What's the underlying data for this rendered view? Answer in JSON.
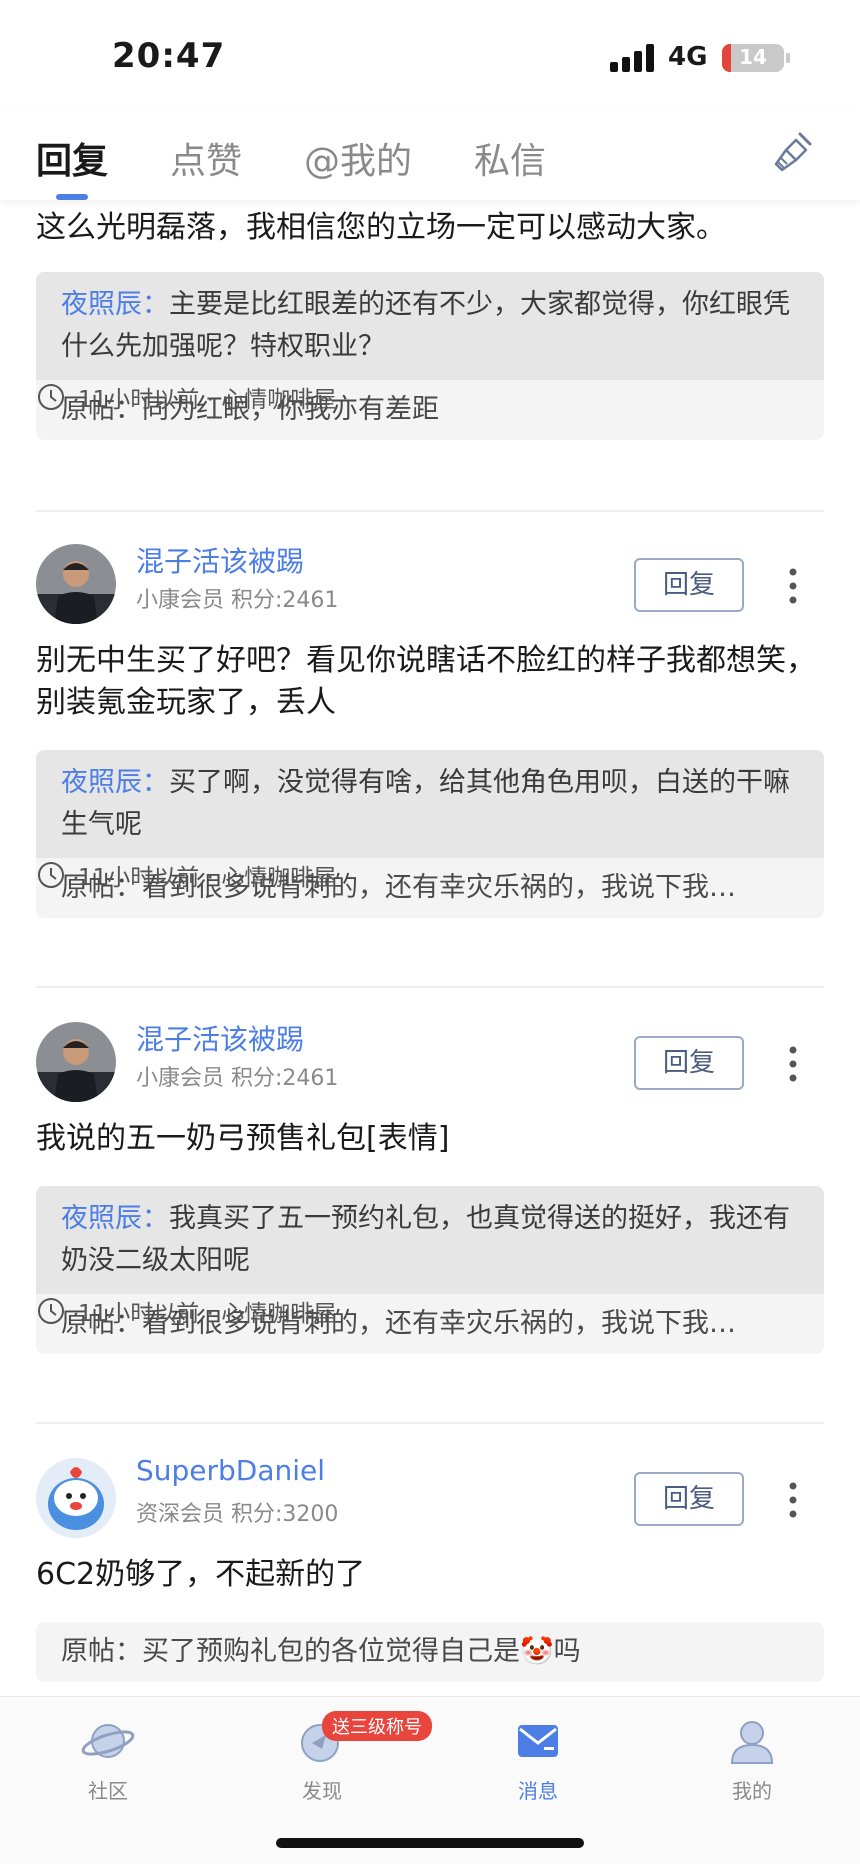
{
  "status_bar": {
    "time": "20:47",
    "network": "4G",
    "battery": "14"
  },
  "tabs": [
    {
      "label": "回复"
    },
    {
      "label": "点赞"
    },
    {
      "label": "@我的"
    },
    {
      "label": "私信"
    }
  ],
  "colors": {
    "accent": "#4d7ee6",
    "badge": "#e8453c",
    "battery_low": "#e5443b"
  },
  "feed": {
    "truncated_item": {
      "text": "这么光明磊落，我相信您的立场一定可以感动大家。",
      "quote_name": "夜照辰：",
      "quote_text": "主要是比红眼差的还有不少，大家都觉得，你红眼凭什么先加强呢？特权职业？",
      "original": "原帖：同为红眼，你我亦有差距",
      "meta": "11小时以前 · 心情咖啡屋"
    },
    "items": [
      {
        "username": "混子活该被踢",
        "level": "小康会员",
        "points": "积分:2461",
        "reply_label": "回复",
        "text": "别无中生买了好吧？看见你说瞎话不脸红的样子我都想笑，别装氪金玩家了，丢人",
        "quote_name": "夜照辰：",
        "quote_text": "买了啊，没觉得有啥，给其他角色用呗，白送的干嘛生气呢",
        "original": "原帖：看到很多说背刺的，还有幸灾乐祸的，我说下我…",
        "meta": "11小时以前 · 心情咖啡屋"
      },
      {
        "username": "混子活该被踢",
        "level": "小康会员",
        "points": "积分:2461",
        "reply_label": "回复",
        "text": "我说的五一奶弓预售礼包[表情]",
        "quote_name": "夜照辰：",
        "quote_text": "我真买了五一预约礼包，也真觉得送的挺好，我还有奶没二级太阳呢",
        "original": "原帖：看到很多说背刺的，还有幸灾乐祸的，我说下我…",
        "meta": "11小时以前 · 心情咖啡屋"
      },
      {
        "username": "SuperbDaniel",
        "level": "资深会员",
        "points": "积分:3200",
        "reply_label": "回复",
        "text": "6C2奶够了，不起新的了",
        "original_prefix": "原帖：买了预购礼包的各位觉得自己是",
        "original_emoji": "🤡",
        "original_suffix": "吗"
      }
    ]
  },
  "bottom_nav": {
    "items": [
      {
        "label": "社区",
        "icon": "planet-icon"
      },
      {
        "label": "发现",
        "icon": "discover-icon"
      },
      {
        "label": "消息",
        "icon": "message-icon"
      },
      {
        "label": "我的",
        "icon": "profile-icon"
      }
    ],
    "badge": "送三级称号"
  }
}
